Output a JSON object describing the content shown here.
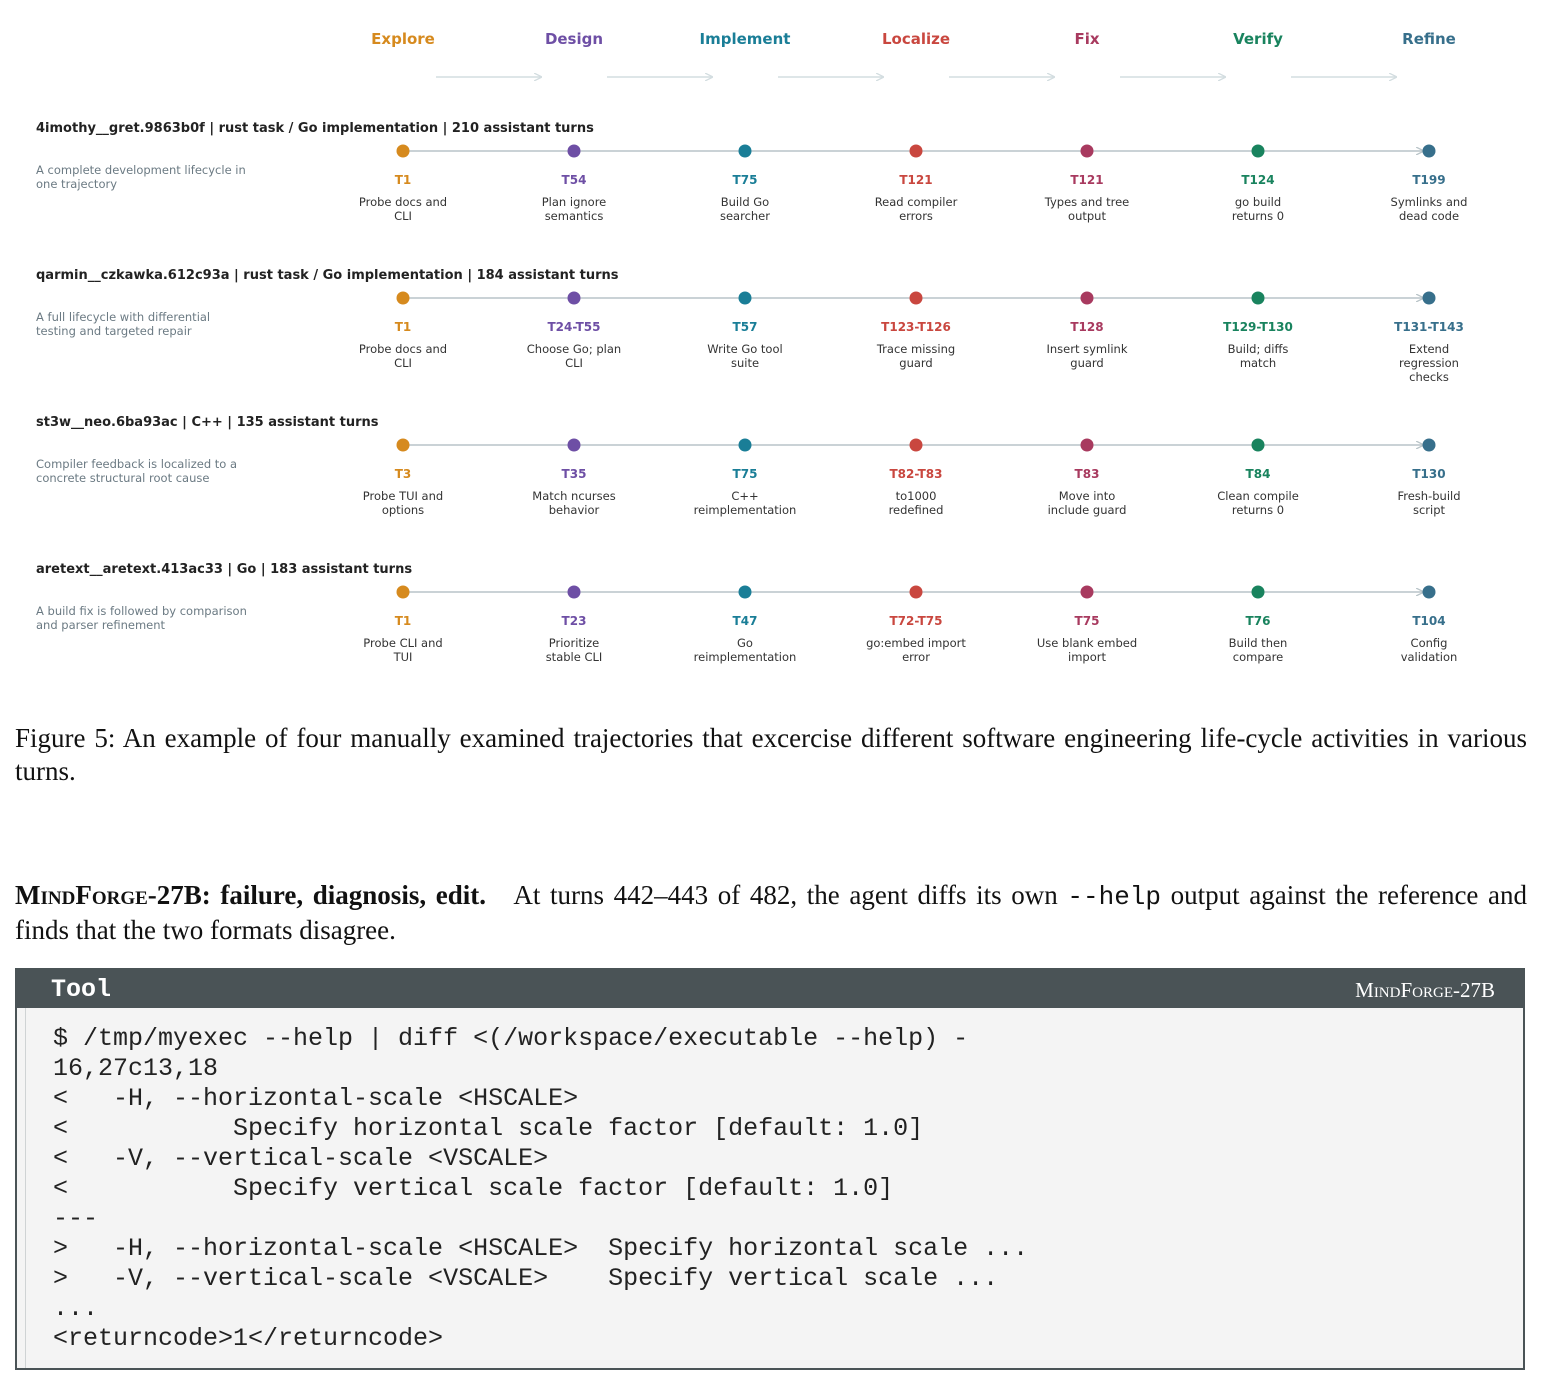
{
  "figure": {
    "stages": [
      {
        "label": "Explore",
        "color": "#d68a1e"
      },
      {
        "label": "Design",
        "color": "#6e4fa5"
      },
      {
        "label": "Implement",
        "color": "#1a7e97"
      },
      {
        "label": "Localize",
        "color": "#c9473f"
      },
      {
        "label": "Fix",
        "color": "#a83a5f"
      },
      {
        "label": "Verify",
        "color": "#19835e"
      },
      {
        "label": "Refine",
        "color": "#376f8b"
      }
    ],
    "trajectories": [
      {
        "header": "4imothy__gret.9863b0f  |  rust task / Go implementation  |  210 assistant turns",
        "description": [
          "A complete development lifecycle in",
          "one trajectory"
        ],
        "events": [
          {
            "turn": "T1",
            "note": [
              "Probe docs and",
              "CLI"
            ]
          },
          {
            "turn": "T54",
            "note": [
              "Plan ignore",
              "semantics"
            ]
          },
          {
            "turn": "T75",
            "note": [
              "Build Go",
              "searcher"
            ]
          },
          {
            "turn": "T121",
            "note": [
              "Read compiler",
              "errors"
            ]
          },
          {
            "turn": "T121",
            "note": [
              "Types and tree",
              "output"
            ]
          },
          {
            "turn": "T124",
            "note": [
              "go build",
              "returns 0"
            ]
          },
          {
            "turn": "T199",
            "note": [
              "Symlinks and",
              "dead code"
            ]
          }
        ]
      },
      {
        "header": "qarmin__czkawka.612c93a  |  rust task / Go implementation  |  184 assistant turns",
        "description": [
          "A full lifecycle with differential",
          "testing and targeted repair"
        ],
        "events": [
          {
            "turn": "T1",
            "note": [
              "Probe docs and",
              "CLI"
            ]
          },
          {
            "turn": "T24-T55",
            "note": [
              "Choose Go; plan",
              "CLI"
            ]
          },
          {
            "turn": "T57",
            "note": [
              "Write Go tool",
              "suite"
            ]
          },
          {
            "turn": "T123-T126",
            "note": [
              "Trace missing",
              "guard"
            ]
          },
          {
            "turn": "T128",
            "note": [
              "Insert symlink",
              "guard"
            ]
          },
          {
            "turn": "T129-T130",
            "note": [
              "Build; diffs",
              "match"
            ]
          },
          {
            "turn": "T131-T143",
            "note": [
              "Extend",
              "regression",
              "checks"
            ]
          }
        ]
      },
      {
        "header": "st3w__neo.6ba93ac  |  C++  |  135 assistant turns",
        "description": [
          "Compiler feedback is localized to a",
          "concrete structural root cause"
        ],
        "events": [
          {
            "turn": "T3",
            "note": [
              "Probe TUI and",
              "options"
            ]
          },
          {
            "turn": "T35",
            "note": [
              "Match ncurses",
              "behavior"
            ]
          },
          {
            "turn": "T75",
            "note": [
              "C++",
              "reimplementation"
            ]
          },
          {
            "turn": "T82-T83",
            "note": [
              "to1000",
              "redefined"
            ]
          },
          {
            "turn": "T83",
            "note": [
              "Move into",
              "include guard"
            ]
          },
          {
            "turn": "T84",
            "note": [
              "Clean compile",
              "returns 0"
            ]
          },
          {
            "turn": "T130",
            "note": [
              "Fresh-build",
              "script"
            ]
          }
        ]
      },
      {
        "header": "aretext__aretext.413ac33  |  Go  |  183 assistant turns",
        "description": [
          "A build fix is followed by comparison",
          "and parser refinement"
        ],
        "events": [
          {
            "turn": "T1",
            "note": [
              "Probe CLI and",
              "TUI"
            ]
          },
          {
            "turn": "T23",
            "note": [
              "Prioritize",
              "stable CLI"
            ]
          },
          {
            "turn": "T47",
            "note": [
              "Go",
              "reimplementation"
            ]
          },
          {
            "turn": "T72-T75",
            "note": [
              "go:embed import",
              "error"
            ]
          },
          {
            "turn": "T75",
            "note": [
              "Use blank embed",
              "import"
            ]
          },
          {
            "turn": "T76",
            "note": [
              "Build then",
              "compare"
            ]
          },
          {
            "turn": "T104",
            "note": [
              "Config",
              "validation"
            ]
          }
        ]
      }
    ]
  },
  "caption": "Figure 5: An example of four manually examined trajectories that excercise different software engineering life-cycle activities in various turns.",
  "paragraph": {
    "model": "MindForge-27B:",
    "heading": "failure, diagnosis, edit.",
    "text_before": "At turns 442–443 of 482, the agent diffs its own",
    "code": "--help",
    "text_after": "output against the reference and finds that the two formats disagree."
  },
  "tool_box": {
    "title": "Tool",
    "model": "MindForge-27B",
    "content": "$ /tmp/myexec --help | diff <(/workspace/executable --help) -\n16,27c13,18\n<   -H, --horizontal-scale <HSCALE>\n<           Specify horizontal scale factor [default: 1.0]\n<   -V, --vertical-scale <VSCALE>\n<           Specify vertical scale factor [default: 1.0]\n---\n>   -H, --horizontal-scale <HSCALE>  Specify horizontal scale ...\n>   -V, --vertical-scale <VSCALE>    Specify vertical scale ...\n...\n<returncode>1</returncode>"
  }
}
